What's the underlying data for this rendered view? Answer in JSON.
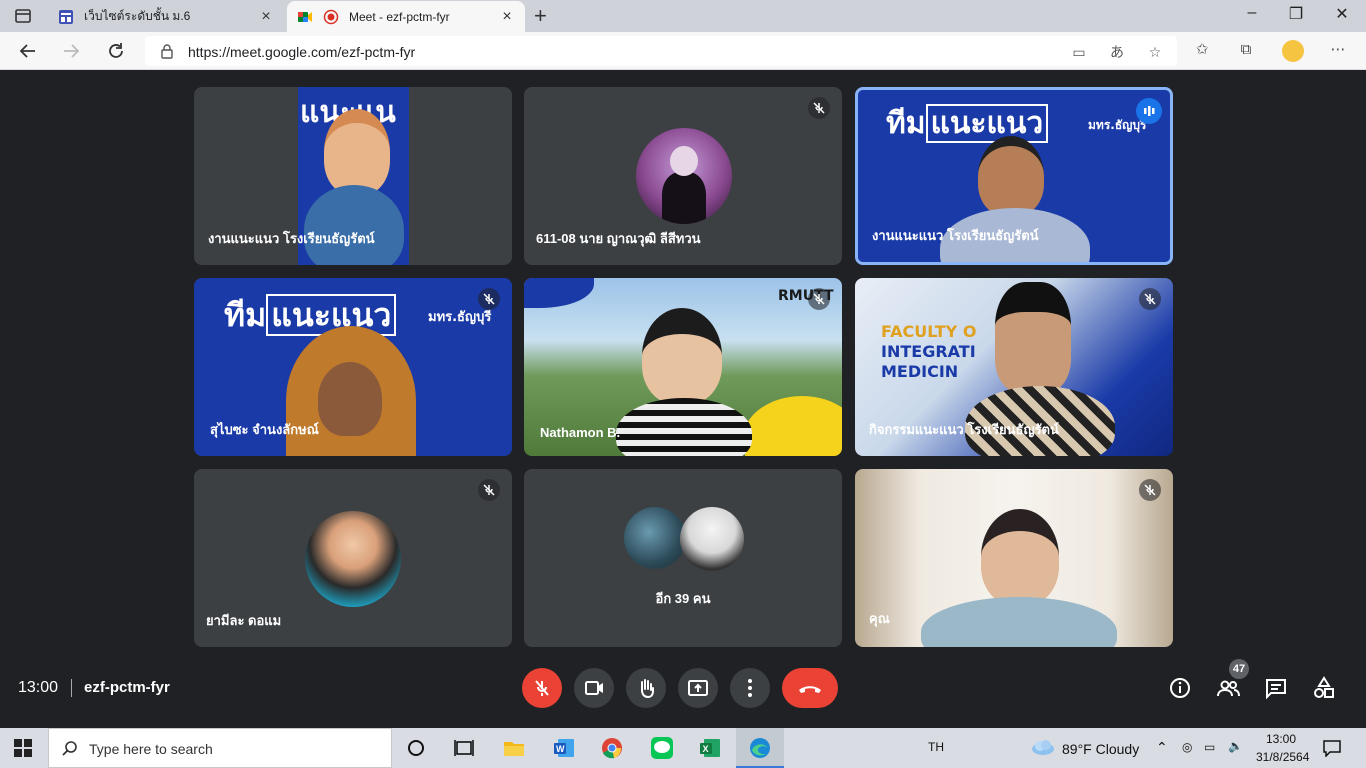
{
  "browser": {
    "tabs": [
      {
        "title": "เว็บไซต์ระดับชั้น ม.6",
        "active": false
      },
      {
        "title": "Meet - ezf-pctm-fyr",
        "active": true
      }
    ],
    "new_tab": "+",
    "url": "https://meet.google.com/ezf-pctm-fyr",
    "translate_icon_text": "あ"
  },
  "tiles": [
    {
      "name": "งานแนะแนว โรงเรียนธัญรัตน์",
      "muted": false,
      "speaking": false,
      "banner": "แนะแน"
    },
    {
      "name": "611-08 นาย ญาณวุฒิ ลีสีทวน",
      "muted": true,
      "speaking": false
    },
    {
      "name": "งานแนะแนว โรงเรียนธัญรัตน์",
      "muted": false,
      "speaking": true,
      "banner_a": "ทีม",
      "banner_b": "แนะแนว",
      "banner_c": "มทร.ธัญบุรี"
    },
    {
      "name": "สุไบซะ จำนงลักษณ์",
      "muted": true,
      "speaking": false,
      "banner_a": "ทีม",
      "banner_b": "แนะแนว",
      "banner_c": "มทร.ธัญบุรี"
    },
    {
      "name": "Nathamon B.",
      "muted": true,
      "speaking": false,
      "logo": "RMUTT"
    },
    {
      "name": "กิจกรรมแนะแนว โรงเรียนธัญรัตน์",
      "muted": true,
      "speaking": false,
      "poster_line1": "FACULTY O",
      "poster_line2": "INTEGRATI",
      "poster_line3": "MEDICIN"
    },
    {
      "name": "ยามีละ ดอแม",
      "muted": true,
      "speaking": false
    },
    {
      "name": "อีก 39 คน",
      "muted": false,
      "speaking": false
    },
    {
      "name": "คุณ",
      "muted": true,
      "speaking": false
    }
  ],
  "meetbar": {
    "time": "13:00",
    "meeting_code": "ezf-pctm-fyr",
    "participants_count": "47"
  },
  "taskbar": {
    "search_placeholder": "Type here to search",
    "language": "TH",
    "weather": "89°F  Cloudy",
    "time": "13:00",
    "date": "31/8/2564"
  },
  "colors": {
    "meet_bg": "#202124",
    "tile_bg": "#3c4043",
    "speaking_border": "#8ab4f8",
    "end_call": "#ea4335",
    "banner_blue": "#1a3aa8"
  }
}
